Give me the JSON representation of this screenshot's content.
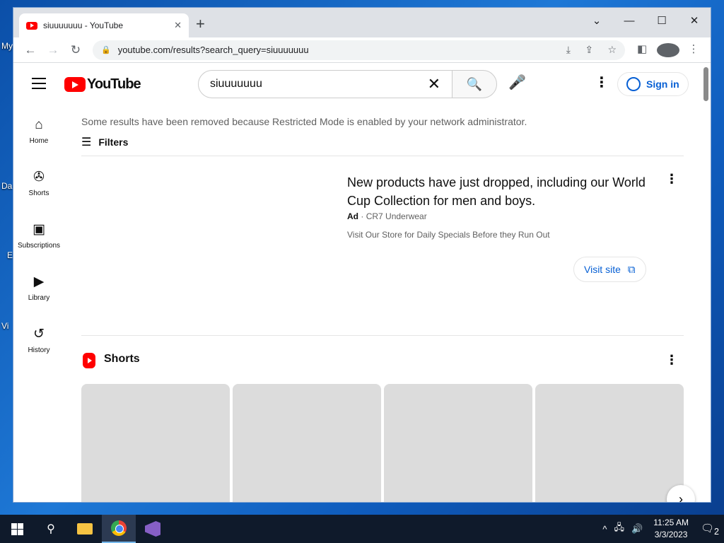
{
  "desktop": {
    "labels": [
      "My",
      "Da",
      "E",
      "Vi"
    ]
  },
  "browser": {
    "tab_title": "siuuuuuuu - YouTube",
    "tab_close": "✕",
    "new_tab": "+",
    "window_controls": {
      "dropdown": "⌄",
      "minimize": "—",
      "maximize": "☐",
      "close": "✕"
    },
    "nav": {
      "back": "←",
      "forward": "→",
      "reload": "↻"
    },
    "lock": "🔒",
    "url": "youtube.com/results?search_query=siuuuuuuu"
  },
  "youtube": {
    "logo_text": "YouTube",
    "search_query": "siuuuuuuu",
    "search_clear": "✕",
    "search_button": "🔍",
    "mic": "🎤",
    "more": "⋮",
    "sign_in": "Sign in",
    "guide": [
      {
        "label": "Home",
        "icon": "⌂"
      },
      {
        "label": "Shorts",
        "icon": "✇"
      },
      {
        "label": "Subscriptions",
        "icon": "▣"
      },
      {
        "label": "Library",
        "icon": "▶"
      },
      {
        "label": "History",
        "icon": "↺"
      }
    ],
    "notice": "Some results have been removed because Restricted Mode is enabled by your network administrator.",
    "filters_label": "Filters",
    "filters_icon": "☰",
    "ad": {
      "title": "New products have just dropped, including our World Cup Collection for men and boys.",
      "badge": "Ad",
      "advertiser": "CR7 Underwear",
      "description": "Visit Our Store for Daily Specials Before they Run Out",
      "visit_label": "Visit site",
      "visit_icon": "⧉",
      "more": "⋮"
    },
    "shorts": {
      "title": "Shorts",
      "more": "⋮",
      "next": "›",
      "card_count": 4
    }
  },
  "taskbar": {
    "search_icon": "⚲",
    "tray_icons": [
      "^",
      "🖧",
      "🔊"
    ],
    "time": "11:25 AM",
    "date": "3/3/2023",
    "notifications": "2"
  }
}
